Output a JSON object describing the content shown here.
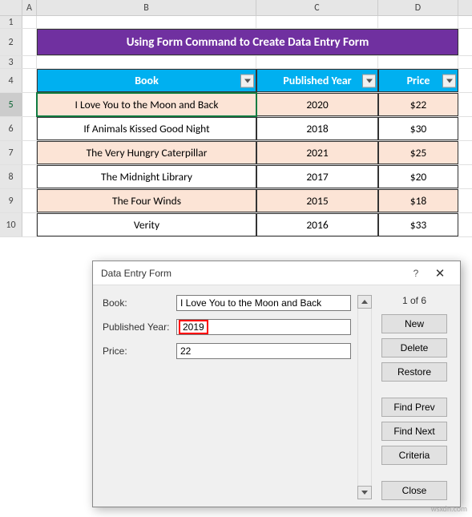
{
  "columns": [
    "A",
    "B",
    "C",
    "D"
  ],
  "row_numbers": [
    "1",
    "2",
    "3",
    "4",
    "5",
    "6",
    "7",
    "8",
    "9",
    "10"
  ],
  "selected_row": "5",
  "title": "Using Form Command to Create Data Entry Form",
  "headers": {
    "book": "Book",
    "year": "Published Year",
    "price": "Price"
  },
  "chart_data": {
    "type": "table",
    "columns": [
      "Book",
      "Published Year",
      "Price"
    ],
    "rows": [
      {
        "book": "I Love You to the Moon and Back",
        "year": "2020",
        "price": "$22"
      },
      {
        "book": "If Animals Kissed Good Night",
        "year": "2018",
        "price": "$30"
      },
      {
        "book": "The Very Hungry Caterpillar",
        "year": "2021",
        "price": "$25"
      },
      {
        "book": "The Midnight Library",
        "year": "2017",
        "price": "$20"
      },
      {
        "book": "The Four Winds",
        "year": "2015",
        "price": "$18"
      },
      {
        "book": "Verity",
        "year": "2016",
        "price": "$33"
      }
    ]
  },
  "dialog": {
    "title": "Data Entry Form",
    "help": "?",
    "close": "✕",
    "counter": "1 of 6",
    "fields": {
      "book_label": "Book:",
      "book_value": "I Love You to the Moon and Back",
      "year_label": "Published Year:",
      "year_value": "2019",
      "price_label": "Price:",
      "price_value": "22"
    },
    "buttons": {
      "new": "New",
      "delete": "Delete",
      "restore": "Restore",
      "find_prev": "Find Prev",
      "find_next": "Find Next",
      "criteria": "Criteria",
      "close": "Close"
    }
  },
  "watermark": "wsxdn.com"
}
